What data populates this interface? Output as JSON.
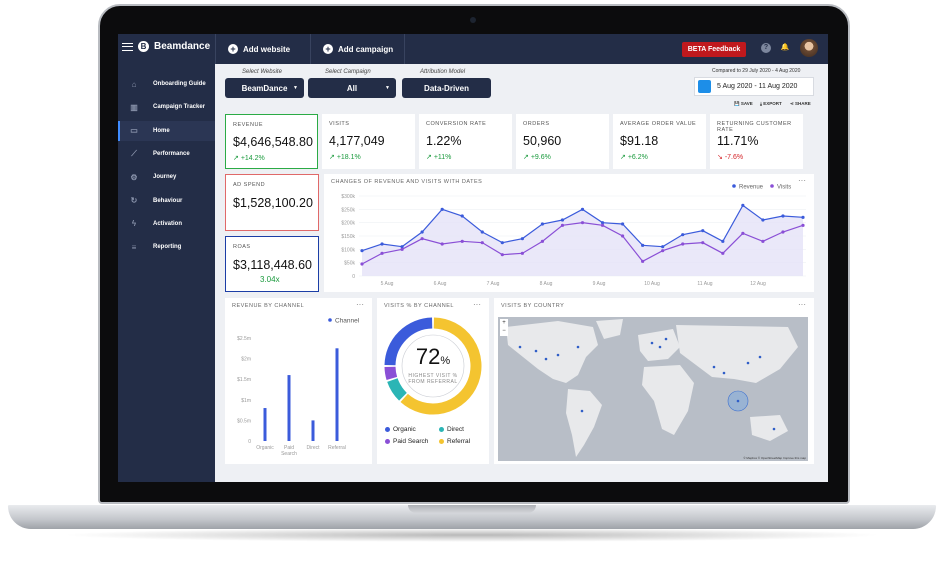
{
  "app": {
    "brand": "Beamdance",
    "add_website": "Add website",
    "add_campaign": "Add campaign",
    "beta_feedback": "BETA Feedback"
  },
  "sidebar": {
    "items": [
      {
        "label": "Onboarding Guide",
        "icon": "home-outline-icon"
      },
      {
        "label": "Campaign Tracker",
        "icon": "bar-chart-icon"
      },
      {
        "label": "Home",
        "icon": "monitor-icon"
      },
      {
        "label": "Performance",
        "icon": "line-chart-icon"
      },
      {
        "label": "Journey",
        "icon": "gear-icon"
      },
      {
        "label": "Behaviour",
        "icon": "cursor-icon"
      },
      {
        "label": "Activation",
        "icon": "lightning-icon"
      },
      {
        "label": "Reporting",
        "icon": "list-icon"
      }
    ],
    "active": "Home"
  },
  "filters": {
    "website": {
      "label": "Select Website",
      "value": "BeamDance"
    },
    "campaign": {
      "label": "Select Campaign",
      "value": "All"
    },
    "attribution": {
      "label": "Attribution Model",
      "value": "Data-Driven"
    },
    "compared": "Compared to 29 July 2020 - 4 Aug 2020",
    "date_range": "5 Aug 2020 - 11 Aug 2020",
    "save": "SAVE",
    "export": "EXPORT",
    "share": "SHARE"
  },
  "kpis": [
    {
      "label": "REVENUE",
      "value": "$4,646,548.80",
      "change": "+14.2%"
    },
    {
      "label": "VISITS",
      "value": "4,177,049",
      "change": "+18.1%"
    },
    {
      "label": "CONVERSION RATE",
      "value": "1.22%",
      "change": "+11%"
    },
    {
      "label": "ORDERS",
      "value": "50,960",
      "change": "+9.6%"
    },
    {
      "label": "AVERAGE ORDER VALUE",
      "value": "$91.18",
      "change": "+6.2%"
    },
    {
      "label": "RETURNING CUSTOMER RATE",
      "value": "11.71%",
      "change": "-7.6%"
    }
  ],
  "ad_spend": {
    "label": "AD SPEND",
    "value": "$1,528,100.20"
  },
  "roas": {
    "label": "ROAS",
    "value": "$3,118,448.60",
    "sub": "3.04x"
  },
  "colors": {
    "navy": "#232d47",
    "blue": "#3b5bdb",
    "purple": "#8a4fd6",
    "green": "#1a9a3d",
    "red": "#d4252a",
    "teal": "#2bb5b5",
    "yellow": "#f4c430"
  },
  "chart_data": [
    {
      "type": "line",
      "title": "CHANGES OF REVENUE AND VISITS WITH DATES",
      "ylim": [
        0,
        300000
      ],
      "yticks": [
        "$300k",
        "$250k",
        "$200k",
        "$150k",
        "$100k",
        "$50k",
        "0"
      ],
      "x_tick_labels": [
        "5 Aug",
        "6 Aug",
        "7 Aug",
        "8 Aug",
        "9 Aug",
        "10 Aug",
        "11 Aug",
        "12 Aug"
      ],
      "series": [
        {
          "name": "Revenue",
          "values": [
            95000,
            120000,
            110000,
            165000,
            250000,
            225000,
            165000,
            125000,
            140000,
            195000,
            210000,
            250000,
            200000,
            195000,
            115000,
            110000,
            155000,
            170000,
            130000,
            265000,
            210000,
            225000,
            220000
          ]
        },
        {
          "name": "Visits",
          "values": [
            45000,
            85000,
            100000,
            140000,
            120000,
            130000,
            125000,
            80000,
            85000,
            130000,
            190000,
            200000,
            190000,
            150000,
            55000,
            95000,
            120000,
            125000,
            85000,
            160000,
            130000,
            165000,
            190000
          ]
        }
      ]
    },
    {
      "type": "bar",
      "title": "REVENUE BY CHANNEL",
      "categories": [
        "Organic",
        "Paid Search",
        "Direct",
        "Referral"
      ],
      "series": [
        {
          "name": "Channel",
          "values": [
            800000,
            1600000,
            500000,
            2250000
          ]
        }
      ],
      "ylim": [
        0,
        2750000
      ],
      "yticks": [
        "$2.5m",
        "$2m",
        "$1.5m",
        "$1m",
        "$0.5m",
        "0"
      ]
    },
    {
      "type": "pie",
      "title": "VISITS % BY CHANNEL",
      "center_value": "72",
      "center_unit": "%",
      "center_text": "HIGHEST VISIT % FROM REFERRAL",
      "slices": [
        {
          "name": "Organic",
          "value": 25
        },
        {
          "name": "Direct",
          "value": 8
        },
        {
          "name": "Paid Search",
          "value": 5
        },
        {
          "name": "Referral",
          "value": 62
        }
      ]
    }
  ],
  "map": {
    "title": "VISITS BY COUNTRY",
    "zoom_in": "+",
    "zoom_out": "−",
    "attribution": "© Mapbox © OpenStreetMap Improve this map"
  }
}
